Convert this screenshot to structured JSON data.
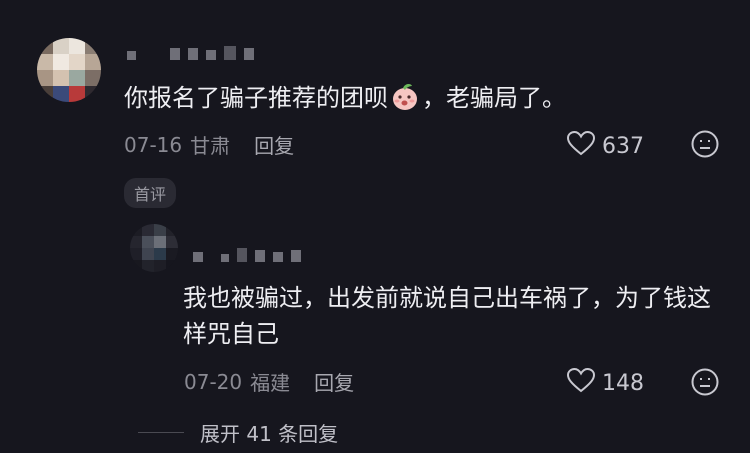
{
  "comments": [
    {
      "text_before": "你报名了骗子推荐的团呗",
      "text_after": "，老骗局了。",
      "date": "07-16",
      "location": "甘肃",
      "reply_label": "回复",
      "likes": "637",
      "badge": "首评"
    },
    {
      "text": "我也被骗过，出发前就说自己出车祸了，为了钱这样咒自己",
      "date": "07-20",
      "location": "福建",
      "reply_label": "回复",
      "likes": "148"
    }
  ],
  "expand_label": "展开 41 条回复",
  "icons": [
    "heart-icon",
    "emoji-icon",
    "peach-emoji-icon"
  ],
  "colors": {
    "background": "#16161e",
    "text": "#eeeef2",
    "meta": "#8a8a93"
  }
}
